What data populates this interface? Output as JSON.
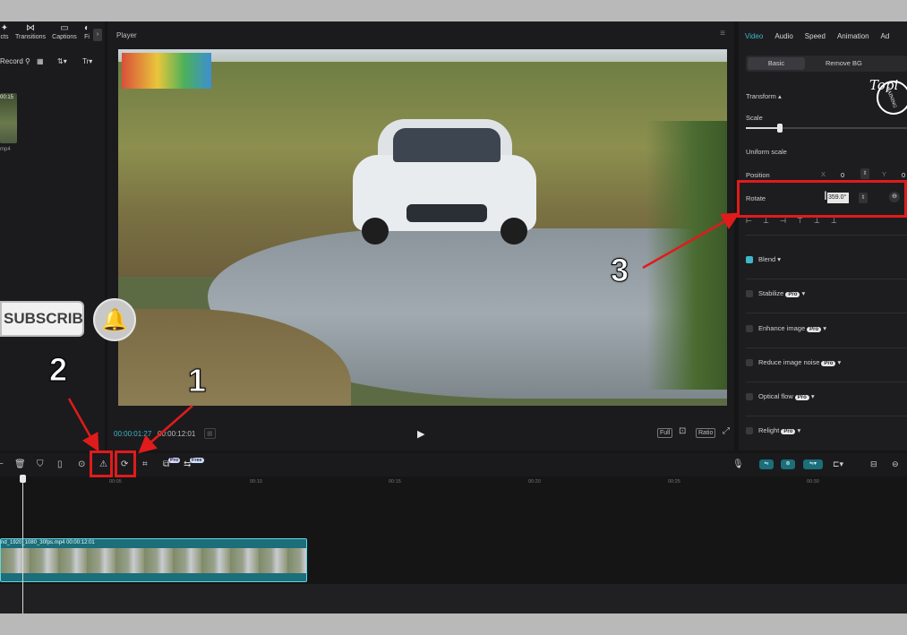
{
  "media": {
    "tabs": [
      "cts",
      "Transitions",
      "Captions",
      "Fi"
    ],
    "tools": [
      "Record",
      "⚲"
    ],
    "thumb_time": "00:15",
    "thumb_name": "mp4"
  },
  "player": {
    "title": "Player",
    "current_time": "00:00:01:27",
    "total_time": "00:00:12:01",
    "buttons": [
      "Full",
      "Ratio"
    ]
  },
  "inspector": {
    "tabs": [
      "Video",
      "Audio",
      "Speed",
      "Animation",
      "Ad"
    ],
    "active_tab": "Video",
    "segments": [
      "Basic",
      "Remove BG"
    ],
    "transform_label": "Transform",
    "scale_label": "Scale",
    "scale_fraction": 0.21,
    "uniform_scale_label": "Uniform scale",
    "position_label": "Position",
    "position_x_label": "X",
    "position_x_value": "0",
    "position_y_label": "Y",
    "position_y_value": "0",
    "rotate_label": "Rotate",
    "rotate_value": "359.0°",
    "options": [
      {
        "label": "Blend",
        "checked": true,
        "pro": false
      },
      {
        "label": "Stabilize",
        "checked": false,
        "pro": true
      },
      {
        "label": "Enhance image",
        "checked": false,
        "pro": true
      },
      {
        "label": "Reduce image noise",
        "checked": false,
        "pro": true
      },
      {
        "label": "Optical flow",
        "checked": false,
        "pro": true
      },
      {
        "label": "Relight",
        "checked": false,
        "pro": true
      }
    ],
    "pro_text": "Pro",
    "logo_text": "Topi",
    "logo_sub": "GAINING"
  },
  "toolbar": {
    "badges": [
      "Pro",
      "Free"
    ]
  },
  "ruler": {
    "ticks": [
      "00:05",
      "00:10",
      "00:15",
      "00:20",
      "00:25",
      "00:30"
    ]
  },
  "clip": {
    "label": "nd_1920_1080_30fps.mp4   00:00:12:01"
  },
  "overlay": {
    "subscribed": "SUBSCRIBED",
    "annotation_numbers": [
      "1",
      "2",
      "3"
    ],
    "highlight_color": "#e01b1b"
  },
  "colors": {
    "accent": "#3fb7c9",
    "clip": "#1b6e7a"
  }
}
